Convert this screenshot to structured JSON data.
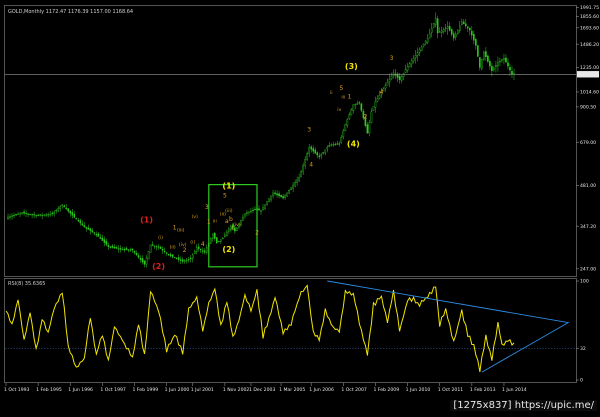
{
  "window": {
    "title": "GOLD,Monthly  1172.47 1176.39 1157.00 1168.64",
    "watermark": "[1275x837] https://upic.me/"
  },
  "colors": {
    "background": "#000000",
    "bull_candle": "#2ecc20",
    "bear_candle": "#2ecc20",
    "price_line": "#9a9a9a",
    "rsi_line": "#f2e600",
    "trendline": "#2f8de4",
    "box": "#2ecc20",
    "wave_red": "#e02020",
    "wave_yellow": "#f2e600",
    "wave_orange": "#d8a020",
    "text": "#d0d0d0"
  },
  "chart_data": [
    {
      "type": "candlestick",
      "name": "GOLD Monthly",
      "title": "GOLD,Monthly  1172.47 1176.39 1157.00 1168.64",
      "x_start": "1993-10",
      "x_step": "month",
      "ylim": [
        237,
        2000
      ],
      "y_scale": "log",
      "y_ticks": [
        {
          "value": 1991.75,
          "label": "1991.75"
        },
        {
          "value": 1855.6,
          "label": "1855.60"
        },
        {
          "value": 1693.6,
          "label": "1693.60"
        },
        {
          "value": 1486.2,
          "label": "1486.20"
        },
        {
          "value": 1235.0,
          "label": "1235.00"
        },
        {
          "value": 1014.6,
          "label": "1014.60"
        },
        {
          "value": 900.5,
          "label": "900.50"
        },
        {
          "value": 679.0,
          "label": "679.00"
        },
        {
          "value": 481.0,
          "label": "481.00"
        },
        {
          "value": 347.2,
          "label": "347.20"
        },
        {
          "value": 247.0,
          "label": "247.00"
        }
      ],
      "current_price": {
        "value": 1168.64,
        "label": "1168.64"
      },
      "close_anchors": [
        [
          "1993-10",
          372
        ],
        [
          "1994-06",
          386
        ],
        [
          "1995-02",
          378
        ],
        [
          "1995-09",
          383
        ],
        [
          "1996-02",
          412
        ],
        [
          "1996-06",
          385
        ],
        [
          "1997-01",
          345
        ],
        [
          "1997-07",
          325
        ],
        [
          "1998-01",
          295
        ],
        [
          "1998-07",
          289
        ],
        [
          "1999-01",
          287
        ],
        [
          "1999-07",
          256
        ],
        [
          "1999-10",
          299
        ],
        [
          "2000-02",
          294
        ],
        [
          "2000-07",
          276
        ],
        [
          "2001-02",
          262
        ],
        [
          "2001-06",
          268
        ],
        [
          "2001-09",
          293
        ],
        [
          "2002-01",
          282
        ],
        [
          "2002-05",
          326
        ],
        [
          "2002-07",
          304
        ],
        [
          "2002-10",
          316
        ],
        [
          "2003-02",
          348
        ],
        [
          "2003-04",
          334
        ],
        [
          "2003-09",
          384
        ],
        [
          "2004-02",
          397
        ],
        [
          "2004-05",
          393
        ],
        [
          "2004-11",
          453
        ],
        [
          "2005-04",
          435
        ],
        [
          "2005-12",
          513
        ],
        [
          "2006-05",
          652
        ],
        [
          "2006-10",
          604
        ],
        [
          "2007-03",
          663
        ],
        [
          "2007-08",
          672
        ],
        [
          "2007-11",
          783
        ],
        [
          "2008-03",
          916
        ],
        [
          "2008-06",
          930
        ],
        [
          "2008-10",
          730
        ],
        [
          "2008-12",
          866
        ],
        [
          "2009-02",
          939
        ],
        [
          "2009-11",
          1182
        ],
        [
          "2010-02",
          1118
        ],
        [
          "2010-06",
          1244
        ],
        [
          "2010-12",
          1421
        ],
        [
          "2011-04",
          1556
        ],
        [
          "2011-08",
          1828
        ],
        [
          "2011-09",
          1624
        ],
        [
          "2012-02",
          1710
        ],
        [
          "2012-05",
          1560
        ],
        [
          "2012-09",
          1776
        ],
        [
          "2013-01",
          1663
        ],
        [
          "2013-04",
          1472
        ],
        [
          "2013-06",
          1234
        ],
        [
          "2013-08",
          1395
        ],
        [
          "2013-12",
          1202
        ],
        [
          "2014-03",
          1284
        ],
        [
          "2014-06",
          1327
        ],
        [
          "2014-10",
          1172
        ],
        [
          "2014-11",
          1168
        ]
      ]
    },
    {
      "type": "line",
      "name": "RSI(8)",
      "title": "RSI(8) 35.6365",
      "ylim": [
        0,
        100
      ],
      "y_ticks": [
        {
          "value": 100,
          "label": "100"
        },
        {
          "value": 32,
          "label": "32"
        },
        {
          "value": 0,
          "label": "0"
        }
      ],
      "level": 32,
      "anchors": [
        [
          "1993-10",
          72
        ],
        [
          "1994-01",
          56
        ],
        [
          "1994-04",
          82
        ],
        [
          "1994-07",
          40
        ],
        [
          "1994-10",
          68
        ],
        [
          "1995-01",
          30
        ],
        [
          "1995-04",
          62
        ],
        [
          "1995-07",
          48
        ],
        [
          "1995-10",
          72
        ],
        [
          "1996-02",
          90
        ],
        [
          "1996-05",
          34
        ],
        [
          "1996-09",
          12
        ],
        [
          "1997-01",
          22
        ],
        [
          "1997-04",
          64
        ],
        [
          "1997-07",
          26
        ],
        [
          "1997-10",
          46
        ],
        [
          "1998-01",
          18
        ],
        [
          "1998-04",
          54
        ],
        [
          "1998-08",
          40
        ],
        [
          "1999-01",
          22
        ],
        [
          "1999-04",
          58
        ],
        [
          "1999-07",
          24
        ],
        [
          "1999-10",
          90
        ],
        [
          "2000-02",
          70
        ],
        [
          "2000-06",
          30
        ],
        [
          "2000-10",
          46
        ],
        [
          "2001-02",
          28
        ],
        [
          "2001-05",
          72
        ],
        [
          "2001-09",
          84
        ],
        [
          "2001-12",
          50
        ],
        [
          "2002-03",
          78
        ],
        [
          "2002-06",
          92
        ],
        [
          "2002-09",
          54
        ],
        [
          "2002-12",
          80
        ],
        [
          "2003-03",
          42
        ],
        [
          "2003-06",
          60
        ],
        [
          "2003-09",
          86
        ],
        [
          "2003-12",
          70
        ],
        [
          "2004-03",
          90
        ],
        [
          "2004-06",
          44
        ],
        [
          "2004-09",
          62
        ],
        [
          "2004-12",
          84
        ],
        [
          "2005-04",
          48
        ],
        [
          "2005-08",
          56
        ],
        [
          "2005-12",
          84
        ],
        [
          "2006-04",
          96
        ],
        [
          "2006-07",
          48
        ],
        [
          "2006-10",
          42
        ],
        [
          "2007-01",
          70
        ],
        [
          "2007-05",
          52
        ],
        [
          "2007-08",
          50
        ],
        [
          "2007-11",
          88
        ],
        [
          "2008-03",
          86
        ],
        [
          "2008-06",
          58
        ],
        [
          "2008-10",
          26
        ],
        [
          "2009-01",
          76
        ],
        [
          "2009-05",
          84
        ],
        [
          "2009-08",
          58
        ],
        [
          "2009-11",
          90
        ],
        [
          "2010-02",
          50
        ],
        [
          "2010-06",
          80
        ],
        [
          "2010-09",
          82
        ],
        [
          "2010-12",
          76
        ],
        [
          "2011-04",
          84
        ],
        [
          "2011-08",
          94
        ],
        [
          "2011-10",
          56
        ],
        [
          "2012-01",
          72
        ],
        [
          "2012-05",
          38
        ],
        [
          "2012-09",
          70
        ],
        [
          "2012-12",
          46
        ],
        [
          "2013-03",
          34
        ],
        [
          "2013-06",
          10
        ],
        [
          "2013-09",
          44
        ],
        [
          "2013-12",
          20
        ],
        [
          "2014-03",
          58
        ],
        [
          "2014-05",
          36
        ],
        [
          "2014-08",
          40
        ],
        [
          "2014-11",
          35.6365
        ]
      ],
      "trendline": [
        {
          "x": "2007-02",
          "y": 100
        },
        {
          "x": "2017-02",
          "y": 58
        },
        {
          "x": "2013-07",
          "y": 8
        }
      ]
    }
  ],
  "x_axis": {
    "start": "1993-10",
    "ticks": [
      {
        "at": "1993-10",
        "label": "1 Oct 1993"
      },
      {
        "at": "1995-02",
        "label": "1 Feb 1995"
      },
      {
        "at": "1996-06",
        "label": "1 Jun 1996"
      },
      {
        "at": "1997-10",
        "label": "1 Oct 1997"
      },
      {
        "at": "1999-02",
        "label": "1 Feb 1999"
      },
      {
        "at": "2000-06",
        "label": "1 Jun 2000"
      },
      {
        "at": "2001-07",
        "label": "1 Jul 2001"
      },
      {
        "at": "2002-11",
        "label": "1 Nov 2002"
      },
      {
        "at": "2003-12",
        "label": "1 Dec 2003"
      },
      {
        "at": "2005-03",
        "label": "1 Mar 2005"
      },
      {
        "at": "2006-06",
        "label": "1 Jun 2006"
      },
      {
        "at": "2007-10",
        "label": "1 Oct 2007"
      },
      {
        "at": "2009-02",
        "label": "1 Feb 2009"
      },
      {
        "at": "2010-06",
        "label": "1 Jun 2010"
      },
      {
        "at": "2011-10",
        "label": "1 Oct 2011"
      },
      {
        "at": "2013-02",
        "label": "1 Feb 2013"
      },
      {
        "at": "2014-06",
        "label": "1 Jun 2014"
      }
    ]
  },
  "box": {
    "from": "2002-03",
    "to": "2004-03",
    "price_low": 251,
    "price_high": 484
  },
  "wave_labels": [
    {
      "text": "(1)",
      "color": "red",
      "at": "1999-08",
      "price": 358
    },
    {
      "text": "(2)",
      "color": "red",
      "at": "2000-02",
      "price": 247
    },
    {
      "text": "(1)",
      "color": "yellow",
      "at": "2003-01",
      "price": 470
    },
    {
      "text": "(2)",
      "color": "yellow",
      "at": "2003-01",
      "price": 283
    },
    {
      "text": "(3)",
      "color": "yellow",
      "at": "2008-02",
      "price": 1218
    },
    {
      "text": "(4)",
      "color": "yellow",
      "at": "2008-03",
      "price": 655
    },
    {
      "text": "1",
      "color": "orange",
      "at": "2000-10",
      "price": 338
    },
    {
      "text": "2",
      "color": "orange",
      "at": "2001-03",
      "price": 283
    },
    {
      "text": "3",
      "color": "orange",
      "at": "2002-02",
      "price": 398
    },
    {
      "text": "4",
      "color": "orange",
      "at": "2001-12",
      "price": 296
    },
    {
      "text": "5",
      "color": "orange",
      "at": "2002-11",
      "price": 437
    },
    {
      "text": "1",
      "color": "orange",
      "at": "2002-03",
      "price": 355
    },
    {
      "text": "2",
      "color": "orange",
      "at": "2004-03",
      "price": 325
    },
    {
      "text": "3",
      "color": "orange",
      "at": "2006-05",
      "price": 740
    },
    {
      "text": "4",
      "color": "orange",
      "at": "2006-06",
      "price": 560
    },
    {
      "text": "5",
      "color": "orange",
      "at": "2007-09",
      "price": 1030
    },
    {
      "text": "1",
      "color": "orange",
      "at": "2008-01",
      "price": 963
    },
    {
      "text": "2",
      "color": "orange",
      "at": "2008-09",
      "price": 820
    },
    {
      "text": "3",
      "color": "orange",
      "at": "2009-10",
      "price": 1310
    },
    {
      "text": "4",
      "color": "orange",
      "at": "2009-05",
      "price": 1000
    },
    {
      "text": "(i)",
      "color": "orange",
      "at": "2000-03",
      "price": 313
    },
    {
      "text": "(ii)",
      "color": "orange",
      "at": "2000-09",
      "price": 290
    },
    {
      "text": "(iii)",
      "color": "orange",
      "at": "2001-01",
      "price": 333
    },
    {
      "text": "(iv)",
      "color": "orange",
      "at": "2001-02",
      "price": 296
    },
    {
      "text": "(v)",
      "color": "orange",
      "at": "2001-08",
      "price": 370
    },
    {
      "text": "(i)",
      "color": "orange",
      "at": "2001-07",
      "price": 302
    },
    {
      "text": "(ii)",
      "color": "orange",
      "at": "2002-10",
      "price": 378
    },
    {
      "text": "(iii)",
      "color": "orange",
      "at": "2003-01",
      "price": 389
    },
    {
      "text": "(iv)",
      "color": "orange",
      "at": "2003-05",
      "price": 348
    },
    {
      "text": "iii",
      "color": "orange",
      "at": "2002-06",
      "price": 358
    },
    {
      "text": "a",
      "color": "orange",
      "at": "2002-12",
      "price": 356
    },
    {
      "text": "b",
      "color": "orange",
      "at": "2003-02",
      "price": 362
    },
    {
      "text": "c",
      "color": "orange",
      "at": "2003-03",
      "price": 338
    },
    {
      "text": "ii",
      "color": "orange",
      "at": "2007-04",
      "price": 1000
    },
    {
      "text": "iv",
      "color": "orange",
      "at": "2007-08",
      "price": 873
    },
    {
      "text": "iii",
      "color": "orange",
      "at": "2007-10",
      "price": 963
    }
  ]
}
